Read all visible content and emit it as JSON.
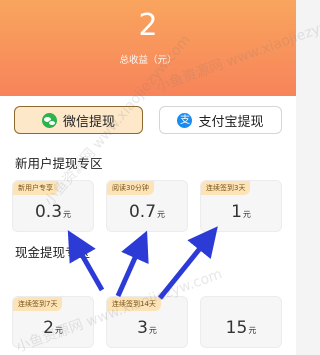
{
  "header": {
    "total": "2",
    "caption": "总收益（元）"
  },
  "tabs": [
    {
      "label": "微信提现",
      "icon": "wechat-icon"
    },
    {
      "label": "支付宝提现",
      "icon": "alipay-icon"
    }
  ],
  "sections": {
    "new_user": {
      "title": "新用户提现专区",
      "cards": [
        {
          "badge": "新用户专享",
          "amount": "0.3",
          "unit": "元"
        },
        {
          "badge": "阅读30分钟",
          "amount": "0.7",
          "unit": "元"
        },
        {
          "badge": "连续签到3天",
          "amount": "1",
          "unit": "元"
        }
      ]
    },
    "cash": {
      "title": "现金提现专区",
      "cards": [
        {
          "badge": "连续签到7天",
          "amount": "2",
          "unit": "元"
        },
        {
          "badge": "连续签到14天",
          "amount": "3",
          "unit": "元"
        },
        {
          "badge": "",
          "amount": "15",
          "unit": "元"
        }
      ]
    }
  },
  "watermark": "小鱼资源网 www.xiaojiezyw.com",
  "colors": {
    "header": "#f7845a",
    "arrow": "#2d3bd6",
    "badge": "#fde4b8"
  }
}
